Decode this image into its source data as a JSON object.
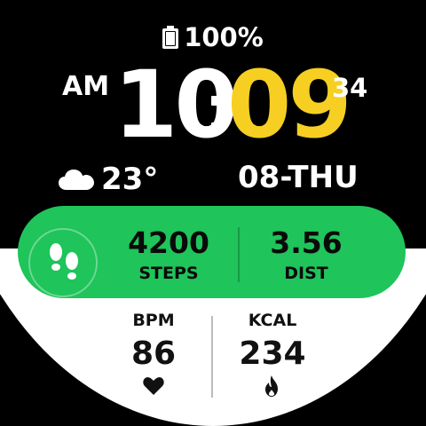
{
  "status": {
    "battery_percent": "100%",
    "battery_icon": "battery-icon"
  },
  "time": {
    "ampm": "AM",
    "hour": "10",
    "minute": "09",
    "seconds": "34"
  },
  "weather": {
    "icon": "cloud-icon",
    "temperature": "23°"
  },
  "date": {
    "text": "08-THU"
  },
  "activity": {
    "icon": "footsteps-icon",
    "steps_value": "4200",
    "steps_label": "STEPS",
    "dist_value": "3.56",
    "dist_label": "DIST"
  },
  "health": {
    "bpm_label": "BPM",
    "bpm_value": "86",
    "bpm_icon": "heart-icon",
    "kcal_label": "KCAL",
    "kcal_value": "234",
    "kcal_icon": "flame-icon"
  },
  "colors": {
    "background": "#000000",
    "minute_accent": "#f6cf22",
    "activity_green": "#1fc45a",
    "lower_panel": "#ffffff"
  }
}
